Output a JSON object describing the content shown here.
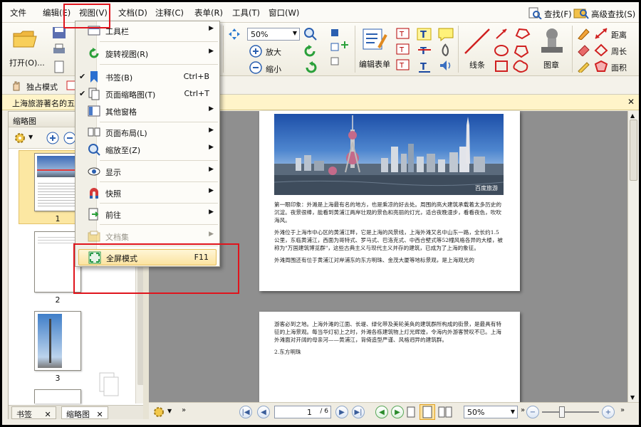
{
  "menubar": {
    "items": [
      "文件",
      "编辑(E)",
      "视图(V)",
      "文档(D)",
      "注释(C)",
      "表单(R)",
      "工具(T)",
      "窗口(W)"
    ],
    "find": "查找(F)",
    "adv_find": "高级查找(S)"
  },
  "ribbon": {
    "open": "打开(O)...",
    "zoom_value": "50%",
    "zoom_in": "放大",
    "zoom_out": "缩小",
    "edit_form": "编辑表单",
    "lines": "线条",
    "stamp": "图章",
    "distance": "距离",
    "perimeter": "周长",
    "area": "面积"
  },
  "tb2": {
    "exclusive_mode": "独占模式"
  },
  "doc_tab": {
    "title": "上海旅游著名的五"
  },
  "view_menu": {
    "items": [
      {
        "label": "工具栏",
        "shortcut": "",
        "submenu": true,
        "icon": "toolbar-icon"
      },
      {
        "label": "旋转视图(R)",
        "shortcut": "",
        "submenu": true,
        "icon": "rotate-view-icon"
      },
      {
        "label": "书签(B)",
        "shortcut": "Ctrl+B",
        "submenu": false,
        "icon": "bookmark-icon",
        "checked": true
      },
      {
        "label": "页面缩略图(T)",
        "shortcut": "Ctrl+T",
        "submenu": false,
        "icon": "page-thumbnails-icon",
        "checked": true
      },
      {
        "label": "其他窗格",
        "shortcut": "",
        "submenu": true,
        "icon": "other-panes-icon"
      },
      {
        "label": "页面布局(L)",
        "shortcut": "",
        "submenu": true,
        "icon": "page-layout-icon"
      },
      {
        "label": "缩放至(Z)",
        "shortcut": "",
        "submenu": true,
        "icon": "zoom-to-icon"
      },
      {
        "label": "显示",
        "shortcut": "",
        "submenu": true,
        "icon": "display-icon"
      },
      {
        "label": "快照",
        "shortcut": "",
        "submenu": true,
        "icon": "snapshot-icon"
      },
      {
        "label": "前往",
        "shortcut": "",
        "submenu": true,
        "icon": "goto-icon"
      },
      {
        "label": "文档集",
        "shortcut": "",
        "submenu": true,
        "icon": "document-collection-icon",
        "disabled": true
      },
      {
        "label": "全屏模式",
        "shortcut": "F11",
        "submenu": false,
        "icon": "fullscreen-icon",
        "highlighted": true
      }
    ]
  },
  "left_panel": {
    "title": "缩略图",
    "thumbs": [
      "1",
      "2",
      "3"
    ],
    "tabs": [
      "书签",
      "缩略图"
    ]
  },
  "document": {
    "watermark": "百度旅游",
    "page1_paragraphs": [
      "第一眼印象：外滩是上海最有名的地方，也是乘凉的好去处。周围的高大建筑承载着太多历史的沉淀。夜景很棒，能看到黄浦江两岸壮观的景色和亮丽的灯光，适合夜晚漫步，看看夜色，吹吹海风。",
      "外滩位于上海市中心区的黄浦江畔，它是上海的风景线，上海外滩又名中山东一路，全长约1.5公里，东临黄浦江，西面为哥特式、罗马式、巴洛克式、中西合壁式等52幢风格各异的大楼，被称为\"万国建筑博览群\"，这些古典主义与现代主义并存的建筑，已成为了上海的象征。",
      "外滩周围还有位于黄浦江对岸浦东的东方明珠、金茂大厦等地标景观，是上海观光的"
    ],
    "page2_paragraphs": [
      "游客必到之地。上海外滩的江面、长堤、绿化带及美轮美奂的建筑群所构成的街景，是最具有特征的上海景观。每当华灯初上之时，外滩各栋建筑物上灯光辉煌，令海内外游客赞叹不已。上海外滩面对开阔的母亲河——黄浦江，背倚造型严谨、风格迥异的建筑群。",
      "2.东方明珠"
    ]
  },
  "status": {
    "page": "1",
    "page_total": "/ 6",
    "zoom": "50%"
  }
}
